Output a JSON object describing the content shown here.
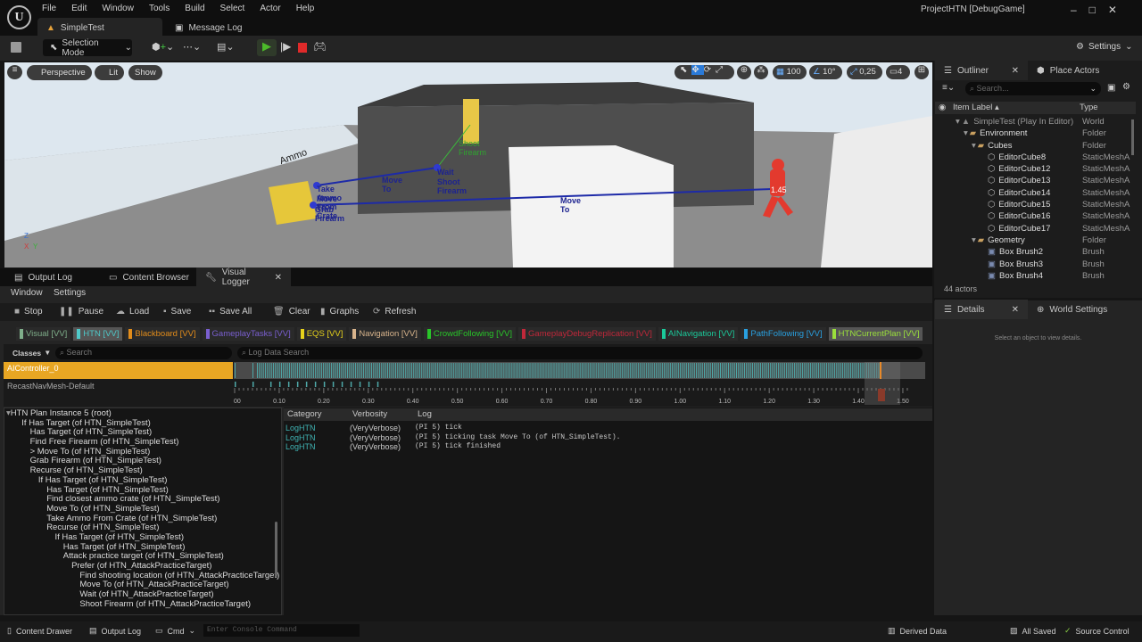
{
  "menu": [
    "File",
    "Edit",
    "Window",
    "Tools",
    "Build",
    "Select",
    "Actor",
    "Help"
  ],
  "project": "ProjectHTN [DebugGame]",
  "doc_tabs": [
    {
      "label": "SimpleTest"
    },
    {
      "label": "Message Log"
    }
  ],
  "toolbar": {
    "mode": "Selection Mode",
    "settings": "Settings"
  },
  "viewport": {
    "perspective": "Perspective",
    "lit": "Lit",
    "show": "Show",
    "grid": "100",
    "angle": "10°",
    "scale": "0,25",
    "camera_speed": "4",
    "labels": {
      "ammo": "Ammo",
      "take_ammo": "Take Ammo From Crate",
      "move_to_1": "Move To",
      "grab_firearm": "Grab Firearm",
      "move_to_2": "Move To",
      "wait": "Wait",
      "shoot_firearm": "Shoot Firearm",
      "shoot_firearm_green": "Shoot Firearm",
      "move_to_3": "Move To",
      "time": "1.45"
    },
    "axes": {
      "z": "Z",
      "x": "X",
      "y": "Y"
    }
  },
  "bottom_tabs": [
    {
      "label": "Output Log"
    },
    {
      "label": "Content Browser"
    },
    {
      "label": "Visual Logger"
    }
  ],
  "vlog_menu": [
    "Window",
    "Settings"
  ],
  "vlog_toolbar": [
    "Stop",
    "Pause",
    "Load",
    "Save",
    "Save All",
    "Clear",
    "Graphs",
    "Refresh"
  ],
  "categories": [
    {
      "label": "Visual [VV]",
      "color": "#7fae8a"
    },
    {
      "label": "HTN [VV]",
      "color": "#4fc9c9",
      "active": true
    },
    {
      "label": "Blackboard [VV]",
      "color": "#e38d1b"
    },
    {
      "label": "GameplayTasks [VV]",
      "color": "#7a5fd0"
    },
    {
      "label": "EQS [VV]",
      "color": "#e7d21b"
    },
    {
      "label": "Navigation [VV]",
      "color": "#d8b48c"
    },
    {
      "label": "CrowdFollowing [VV]",
      "color": "#29c529"
    },
    {
      "label": "GameplayDebugReplication [VV]",
      "color": "#c0283a"
    },
    {
      "label": "AINavigation [VV]",
      "color": "#1bc99a"
    },
    {
      "label": "PathFollowing [VV]",
      "color": "#29a0e0"
    },
    {
      "label": "HTNCurrentPlan [VV]",
      "color": "#9be03c",
      "active": true
    }
  ],
  "classes_label": "Classes",
  "search_placeholder": "Search",
  "log_search_placeholder": "Log Data Search",
  "rows": [
    "AIController_0",
    "RecastNavMesh-Default"
  ],
  "timeline": {
    "ticks": [
      "0.00",
      "0.10",
      "0.20",
      "0.30",
      "0.40",
      "0.50",
      "0.60",
      "0.70",
      "0.80",
      "0.90",
      "1.00",
      "1.10",
      "1.20",
      "1.30",
      "1.40",
      "1.50"
    ],
    "cursor": 1.45
  },
  "htn_tree": [
    {
      "t": "HTN Plan Instance 5 (root)",
      "d": 0
    },
    {
      "t": "If Has Target (of HTN_SimpleTest)",
      "d": 1
    },
    {
      "t": "Has Target (of HTN_SimpleTest)",
      "d": 2
    },
    {
      "t": "Find Free Firearm (of HTN_SimpleTest)",
      "d": 2
    },
    {
      "t": "> Move To (of HTN_SimpleTest)",
      "d": 2
    },
    {
      "t": "Grab Firearm (of HTN_SimpleTest)",
      "d": 2
    },
    {
      "t": "Recurse (of HTN_SimpleTest)",
      "d": 2
    },
    {
      "t": "If Has Target (of HTN_SimpleTest)",
      "d": 3
    },
    {
      "t": "Has Target (of HTN_SimpleTest)",
      "d": 4
    },
    {
      "t": "Find closest ammo crate (of HTN_SimpleTest)",
      "d": 4
    },
    {
      "t": "Move To (of HTN_SimpleTest)",
      "d": 4
    },
    {
      "t": "Take Ammo From Crate (of HTN_SimpleTest)",
      "d": 4
    },
    {
      "t": "Recurse (of HTN_SimpleTest)",
      "d": 4
    },
    {
      "t": "If Has Target (of HTN_SimpleTest)",
      "d": 5
    },
    {
      "t": "Has Target (of HTN_SimpleTest)",
      "d": 6
    },
    {
      "t": "Attack practice target (of HTN_SimpleTest)",
      "d": 6
    },
    {
      "t": "Prefer (of HTN_AttackPracticeTarget)",
      "d": 7
    },
    {
      "t": "Find shooting location (of HTN_AttackPracticeTarget)",
      "d": 8
    },
    {
      "t": "Move To (of HTN_AttackPracticeTarget)",
      "d": 8
    },
    {
      "t": "Wait (of HTN_AttackPracticeTarget)",
      "d": 8
    },
    {
      "t": "Shoot Firearm (of HTN_AttackPracticeTarget)",
      "d": 8
    }
  ],
  "log_headers": [
    "Category",
    "Verbosity",
    "Log"
  ],
  "log_rows": [
    {
      "c": "LogHTN",
      "v": "(VeryVerbose)",
      "l": "(PI 5) tick"
    },
    {
      "c": "LogHTN",
      "v": "(VeryVerbose)",
      "l": "(PI 5) ticking task Move To (of HTN_SimpleTest)."
    },
    {
      "c": "LogHTN",
      "v": "(VeryVerbose)",
      "l": "(PI 5) tick finished"
    }
  ],
  "outliner": {
    "tab": "Outliner",
    "place_actors": "Place Actors",
    "search_placeholder": "Search...",
    "col_label": "Item Label",
    "col_type": "Type",
    "count": "44 actors",
    "items": [
      {
        "n": "SimpleTest (Play In Editor)",
        "t": "World",
        "d": 0,
        "k": "world"
      },
      {
        "n": "Environment",
        "t": "Folder",
        "d": 1,
        "k": "folder"
      },
      {
        "n": "Cubes",
        "t": "Folder",
        "d": 2,
        "k": "folder"
      },
      {
        "n": "EditorCube8",
        "t": "StaticMeshA",
        "d": 3,
        "k": "mesh"
      },
      {
        "n": "EditorCube12",
        "t": "StaticMeshA",
        "d": 3,
        "k": "mesh"
      },
      {
        "n": "EditorCube13",
        "t": "StaticMeshA",
        "d": 3,
        "k": "mesh"
      },
      {
        "n": "EditorCube14",
        "t": "StaticMeshA",
        "d": 3,
        "k": "mesh"
      },
      {
        "n": "EditorCube15",
        "t": "StaticMeshA",
        "d": 3,
        "k": "mesh"
      },
      {
        "n": "EditorCube16",
        "t": "StaticMeshA",
        "d": 3,
        "k": "mesh"
      },
      {
        "n": "EditorCube17",
        "t": "StaticMeshA",
        "d": 3,
        "k": "mesh"
      },
      {
        "n": "Geometry",
        "t": "Folder",
        "d": 2,
        "k": "folder"
      },
      {
        "n": "Box Brush2",
        "t": "Brush",
        "d": 3,
        "k": "brush"
      },
      {
        "n": "Box Brush3",
        "t": "Brush",
        "d": 3,
        "k": "brush"
      },
      {
        "n": "Box Brush4",
        "t": "Brush",
        "d": 3,
        "k": "brush"
      }
    ]
  },
  "details": {
    "tab": "Details",
    "world_settings": "World Settings",
    "empty": "Select an object to view details."
  },
  "statusbar": {
    "content_drawer": "Content Drawer",
    "output_log": "Output Log",
    "cmd": "Cmd",
    "console_placeholder": "Enter Console Command",
    "derived_data": "Derived Data",
    "all_saved": "All Saved",
    "source_control": "Source Control"
  }
}
